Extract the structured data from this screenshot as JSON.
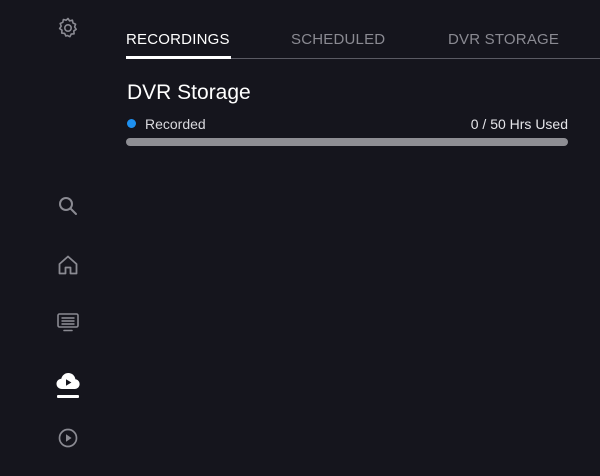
{
  "sidebar": {
    "items": [
      {
        "icon": "gear-icon"
      },
      {
        "icon": "search-icon"
      },
      {
        "icon": "home-icon"
      },
      {
        "icon": "guide-icon"
      },
      {
        "icon": "cloud-dvr-icon",
        "active": true
      },
      {
        "icon": "play-circle-icon"
      }
    ]
  },
  "tabs": [
    {
      "label": "RECORDINGS",
      "active": true
    },
    {
      "label": "SCHEDULED",
      "active": false
    },
    {
      "label": "DVR STORAGE",
      "active": false
    }
  ],
  "storage": {
    "title": "DVR Storage",
    "legend_label": "Recorded",
    "usage_text": "0 / 50 Hrs Used",
    "used_hours": 0,
    "total_hours": 50
  },
  "colors": {
    "background": "#15151d",
    "accent": "#1e90f0",
    "track": "#8e8e94",
    "inactive_text": "#8a8a92"
  }
}
